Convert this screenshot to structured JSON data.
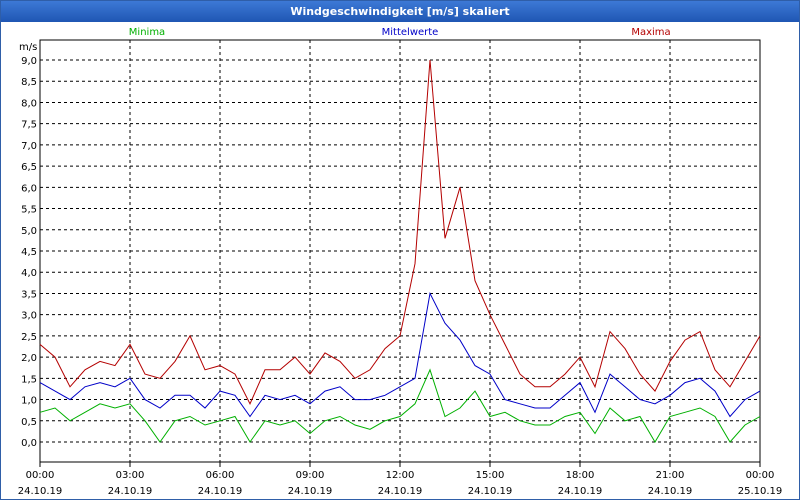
{
  "window": {
    "title": "Windgeschwindigkeit [m/s] skaliert"
  },
  "chart_data": {
    "type": "line",
    "title": "Windgeschwindigkeit [m/s] skaliert",
    "ylabel": "m/s",
    "ylim": [
      0,
      9.0
    ],
    "y_ticks": [
      "9,0",
      "8,5",
      "8,0",
      "7,5",
      "7,0",
      "6,5",
      "6,0",
      "5,5",
      "5,0",
      "4,5",
      "4,0",
      "3,5",
      "3,0",
      "2,5",
      "2,0",
      "1,5",
      "1,0",
      "0,5",
      "0,0"
    ],
    "x_ticks": [
      {
        "time": "00:00",
        "date": "24.10.19"
      },
      {
        "time": "03:00",
        "date": "24.10.19"
      },
      {
        "time": "06:00",
        "date": "24.10.19"
      },
      {
        "time": "09:00",
        "date": "24.10.19"
      },
      {
        "time": "12:00",
        "date": "24.10.19"
      },
      {
        "time": "15:00",
        "date": "24.10.19"
      },
      {
        "time": "18:00",
        "date": "24.10.19"
      },
      {
        "time": "21:00",
        "date": "24.10.19"
      },
      {
        "time": "00:00",
        "date": "25.10.19"
      }
    ],
    "x_hours": [
      0,
      0.5,
      1,
      1.5,
      2,
      2.5,
      3,
      3.5,
      4,
      4.5,
      5,
      5.5,
      6,
      6.5,
      7,
      7.5,
      8,
      8.5,
      9,
      9.5,
      10,
      10.5,
      11,
      11.5,
      12,
      12.5,
      13,
      13.5,
      14,
      14.5,
      15,
      15.5,
      16,
      16.5,
      17,
      17.5,
      18,
      18.5,
      19,
      19.5,
      20,
      20.5,
      21,
      21.5,
      22,
      22.5,
      23,
      23.5,
      24
    ],
    "grid": true,
    "legend": "top",
    "colors": {
      "Minima": "#00b000",
      "Mittelwerte": "#0000c8",
      "Maxima": "#b40000"
    },
    "series": [
      {
        "name": "Minima",
        "values": [
          0.7,
          0.8,
          0.5,
          0.7,
          0.9,
          0.8,
          0.9,
          0.5,
          0.0,
          0.5,
          0.6,
          0.4,
          0.5,
          0.6,
          0.0,
          0.5,
          0.4,
          0.5,
          0.2,
          0.5,
          0.6,
          0.4,
          0.3,
          0.5,
          0.6,
          0.9,
          1.7,
          0.6,
          0.8,
          1.2,
          0.6,
          0.7,
          0.5,
          0.4,
          0.4,
          0.6,
          0.7,
          0.2,
          0.8,
          0.5,
          0.6,
          0.0,
          0.6,
          0.7,
          0.8,
          0.6,
          0.0,
          0.4,
          0.6
        ]
      },
      {
        "name": "Mittelwerte",
        "values": [
          1.4,
          1.2,
          1.0,
          1.3,
          1.4,
          1.3,
          1.5,
          1.0,
          0.8,
          1.1,
          1.1,
          0.8,
          1.2,
          1.1,
          0.6,
          1.1,
          1.0,
          1.1,
          0.9,
          1.2,
          1.3,
          1.0,
          1.0,
          1.1,
          1.3,
          1.5,
          3.5,
          2.8,
          2.4,
          1.8,
          1.6,
          1.0,
          0.9,
          0.8,
          0.8,
          1.1,
          1.4,
          0.7,
          1.6,
          1.3,
          1.0,
          0.9,
          1.1,
          1.4,
          1.5,
          1.2,
          0.6,
          1.0,
          1.2
        ]
      },
      {
        "name": "Maxima",
        "values": [
          2.3,
          2.0,
          1.3,
          1.7,
          1.9,
          1.8,
          2.3,
          1.6,
          1.5,
          1.9,
          2.5,
          1.7,
          1.8,
          1.6,
          0.9,
          1.7,
          1.7,
          2.0,
          1.6,
          2.1,
          1.9,
          1.5,
          1.7,
          2.2,
          2.5,
          4.2,
          9.0,
          4.8,
          6.0,
          3.8,
          3.0,
          2.3,
          1.6,
          1.3,
          1.3,
          1.6,
          2.0,
          1.3,
          2.6,
          2.2,
          1.6,
          1.2,
          1.9,
          2.4,
          2.6,
          1.7,
          1.3,
          1.9,
          2.5
        ]
      }
    ]
  }
}
